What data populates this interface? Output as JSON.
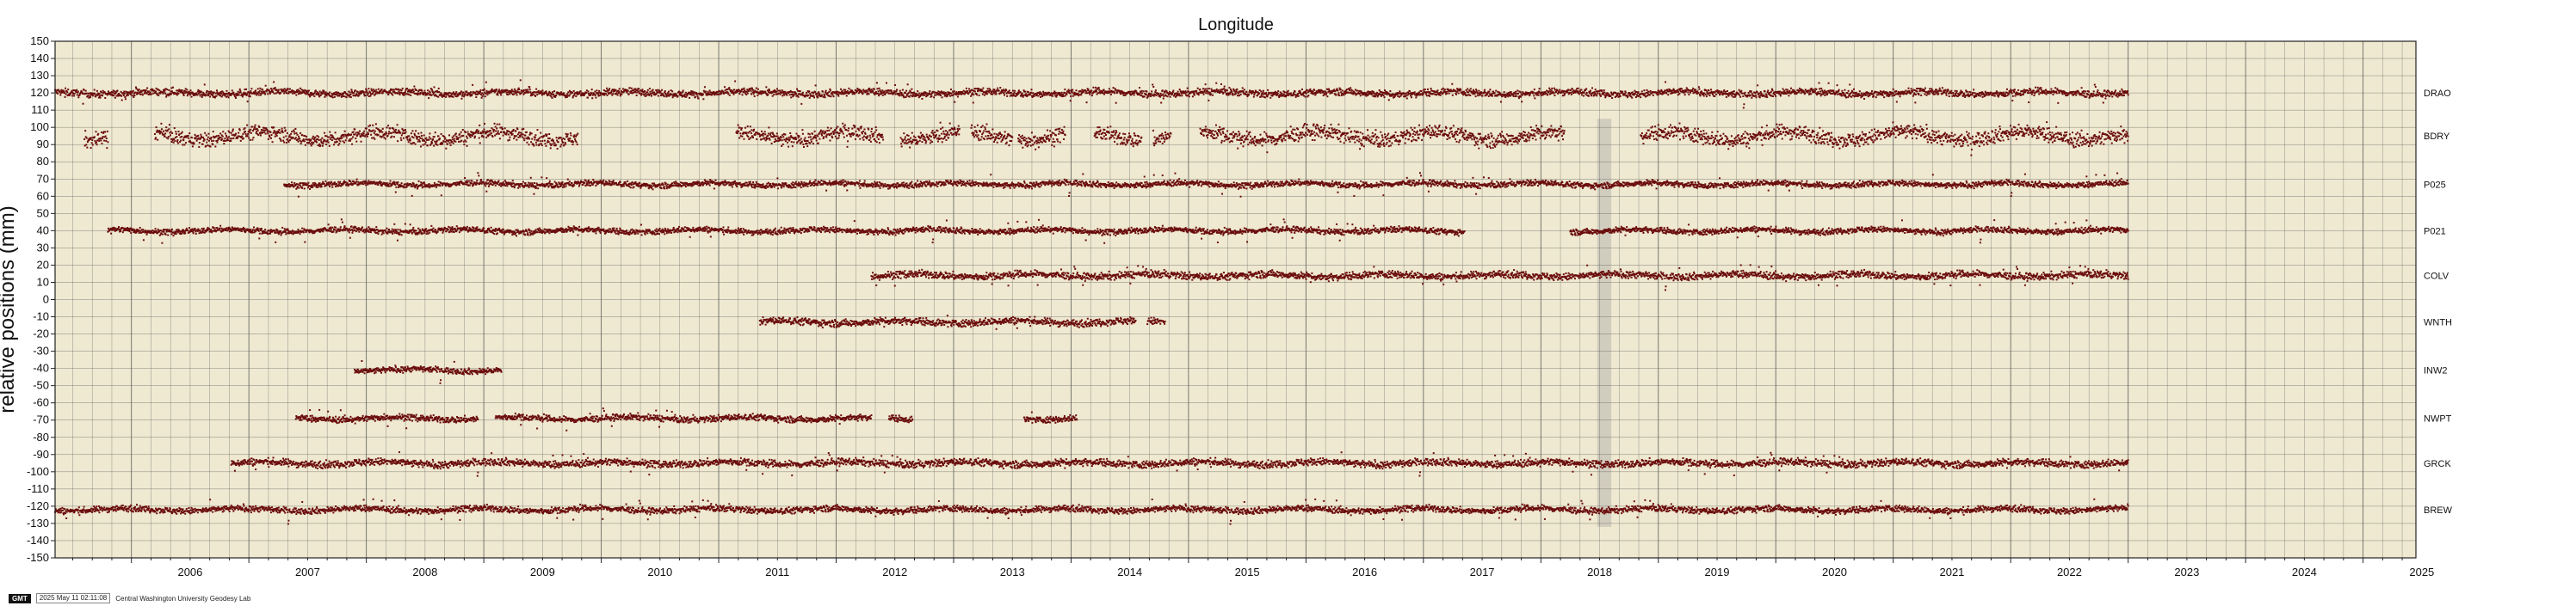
{
  "footer": {
    "logo": "GMT",
    "timestamp": "2025 May 11 02:11:08",
    "credit": "Central Washington University Geodesy Lab"
  },
  "colors": {
    "plot_bg": "#efe9d1",
    "grid": "#555555",
    "points": "#6b0d0d",
    "model_band": "#9a9a9a",
    "text": "#111111"
  },
  "chart_data": {
    "type": "scatter",
    "title": "Longitude",
    "xlabel": "",
    "ylabel": "relative positions (mm)",
    "xlim": [
      2005.35,
      2025.45
    ],
    "ylim": [
      -150,
      150
    ],
    "y_tick_step": 10,
    "x_tick_labels": [
      "2006",
      "2007",
      "2008",
      "2009",
      "2010",
      "2011",
      "2012",
      "2013",
      "2014",
      "2015",
      "2016",
      "2017",
      "2018",
      "2019",
      "2020",
      "2021",
      "2022",
      "2023",
      "2024",
      "2025"
    ],
    "grid": true,
    "series": [
      {
        "name": "DRAO",
        "offset": 120,
        "segments": [
          [
            2005.35,
            2023.0
          ]
        ],
        "scatter": 1.5
      },
      {
        "name": "BDRY",
        "offset": 95,
        "segments": [
          [
            2005.6,
            2005.8
          ],
          [
            2006.2,
            2006.7
          ],
          [
            2006.7,
            2009.8
          ],
          [
            2011.15,
            2012.4
          ],
          [
            2012.55,
            2013.05
          ],
          [
            2013.15,
            2013.5
          ],
          [
            2013.55,
            2013.95
          ],
          [
            2014.2,
            2014.6
          ],
          [
            2014.7,
            2014.85
          ],
          [
            2015.1,
            2018.2
          ],
          [
            2018.85,
            2023.0
          ]
        ],
        "scatter": 3
      },
      {
        "name": "P025",
        "offset": 67,
        "segments": [
          [
            2007.3,
            2023.0
          ]
        ],
        "scatter": 1.2
      },
      {
        "name": "P021",
        "offset": 40,
        "segments": [
          [
            2005.8,
            2017.35
          ],
          [
            2018.25,
            2023.0
          ]
        ],
        "scatter": 1.2
      },
      {
        "name": "COLV",
        "offset": 14,
        "segments": [
          [
            2012.3,
            2023.0
          ]
        ],
        "scatter": 1.5
      },
      {
        "name": "WNTH",
        "offset": -13,
        "segments": [
          [
            2011.35,
            2014.55
          ],
          [
            2014.65,
            2014.8
          ]
        ],
        "scatter": 1.5
      },
      {
        "name": "INW2",
        "offset": -41,
        "segments": [
          [
            2007.9,
            2009.15
          ]
        ],
        "scatter": 1.2
      },
      {
        "name": "NWPT",
        "offset": -69,
        "segments": [
          [
            2007.4,
            2008.95
          ],
          [
            2009.1,
            2012.3
          ],
          [
            2012.45,
            2012.65
          ],
          [
            2013.6,
            2014.05
          ]
        ],
        "scatter": 1.3
      },
      {
        "name": "GRCK",
        "offset": -95,
        "segments": [
          [
            2006.85,
            2023.0
          ]
        ],
        "scatter": 1.5
      },
      {
        "name": "BREW",
        "offset": -122,
        "segments": [
          [
            2005.35,
            2023.0
          ]
        ],
        "scatter": 1.3
      }
    ]
  }
}
